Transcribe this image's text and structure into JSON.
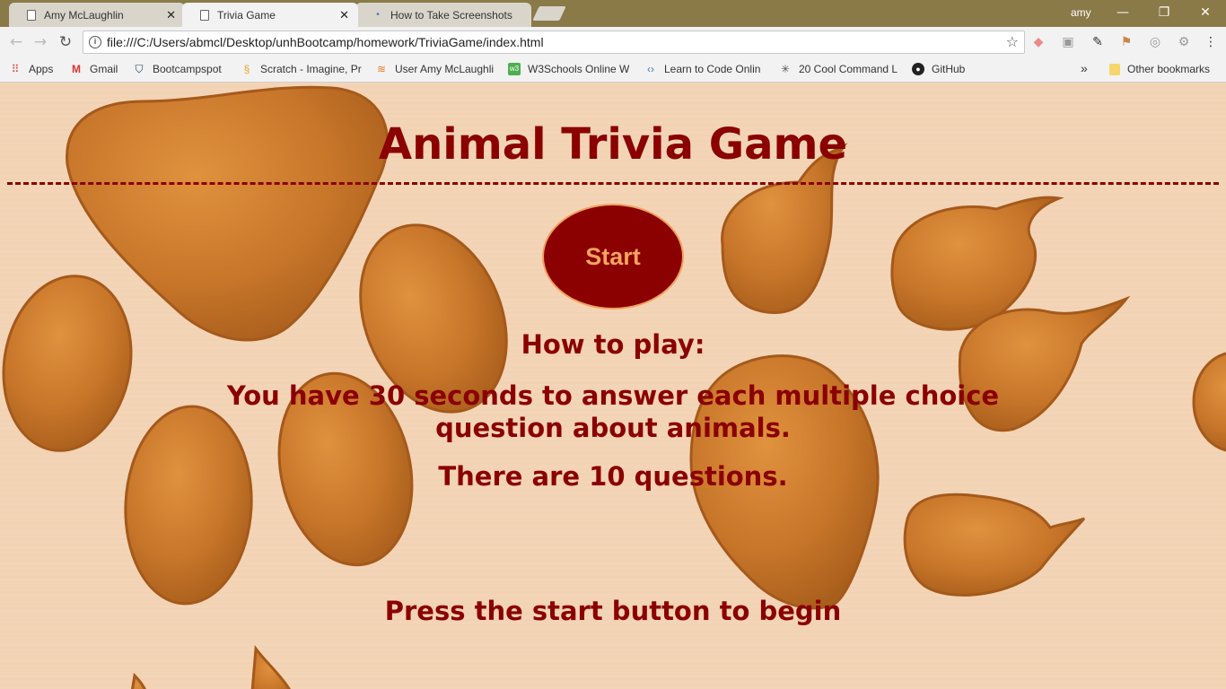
{
  "browser": {
    "tabs": [
      {
        "title": "Amy McLaughlin",
        "active": false
      },
      {
        "title": "Trivia Game",
        "active": true
      },
      {
        "title": "How to Take Screenshots",
        "active": false
      }
    ],
    "profile": "amy",
    "url": "file:///C:/Users/abmcl/Desktop/unhBootcamp/homework/TriviaGame/index.html",
    "bookmarks": [
      {
        "label": "Apps",
        "icon": "apps-grid-icon"
      },
      {
        "label": "Gmail",
        "icon": "gmail-icon"
      },
      {
        "label": "Bootcampspot",
        "icon": "bootcampspot-icon"
      },
      {
        "label": "Scratch - Imagine, Pr",
        "icon": "scratch-icon"
      },
      {
        "label": "User Amy McLaughli",
        "icon": "stackoverflow-icon"
      },
      {
        "label": "W3Schools Online W",
        "icon": "w3schools-icon"
      },
      {
        "label": "Learn to Code Onlin",
        "icon": "code-icon"
      },
      {
        "label": "20 Cool Command L",
        "icon": "command-icon"
      },
      {
        "label": "GitHub",
        "icon": "github-icon"
      }
    ],
    "bookmarks_more": "»",
    "other_bookmarks": "Other bookmarks"
  },
  "page": {
    "title": "Animal Trivia Game",
    "start_button": "Start",
    "how_to_play_heading": "How to play:",
    "rule_time": "You have 30 seconds to answer each multiple choice question about animals.",
    "rule_count": "There are 10 questions.",
    "press_start": "Press the start button to begin"
  },
  "colors": {
    "accent": "#8b0000",
    "button_text": "#f4a460",
    "background": "#f2d5b8",
    "paw_print": "#c8762a"
  }
}
